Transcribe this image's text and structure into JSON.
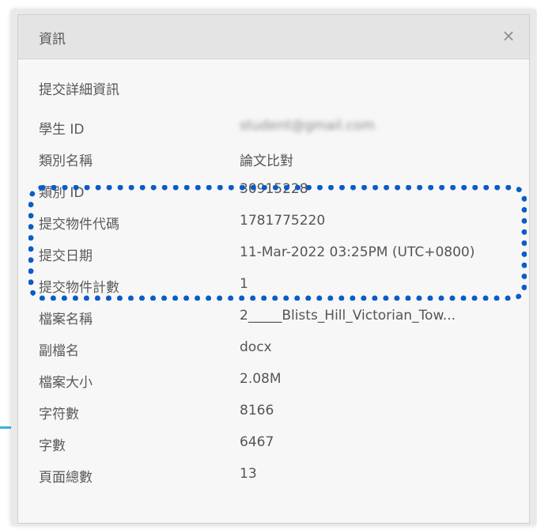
{
  "dialog": {
    "title": "資訊",
    "close_glyph": "×"
  },
  "section_title": "提交詳細資訊",
  "rows": [
    {
      "label": "學生 ID",
      "value": "student@gmail.com",
      "blurred": true
    },
    {
      "label": "類別名稱",
      "value": "論文比對",
      "blurred": false
    },
    {
      "label": "類別 ID",
      "value": "30915228",
      "blurred": false
    },
    {
      "label": "提交物件代碼",
      "value": "1781775220",
      "blurred": false
    },
    {
      "label": "提交日期",
      "value": "11-Mar-2022 03:25PM (UTC+0800)",
      "blurred": false
    },
    {
      "label": "提交物件計數",
      "value": "1",
      "blurred": false
    },
    {
      "label": "檔案名稱",
      "value": "2_____Blists_Hill_Victorian_Tow...",
      "blurred": false
    },
    {
      "label": "副檔名",
      "value": "docx",
      "blurred": false
    },
    {
      "label": "檔案大小",
      "value": "2.08M",
      "blurred": false
    },
    {
      "label": "字符數",
      "value": "8166",
      "blurred": false
    },
    {
      "label": "字數",
      "value": "6467",
      "blurred": false
    },
    {
      "label": "頁面總數",
      "value": "13",
      "blurred": false
    }
  ],
  "colors": {
    "highlight": "#0a5cc7",
    "accent_line": "#3ab5d6"
  }
}
